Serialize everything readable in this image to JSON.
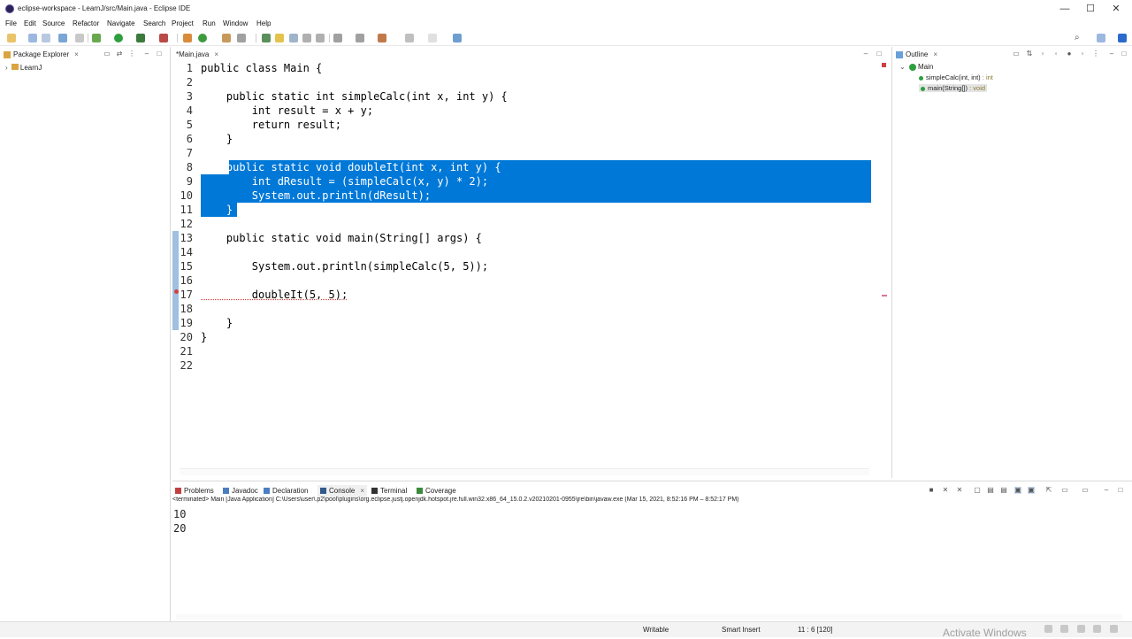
{
  "window": {
    "title": "eclipse-workspace - LearnJ/src/Main.java - Eclipse IDE",
    "minimize": "—",
    "maximize": "☐",
    "close": "✕"
  },
  "menu": [
    "File",
    "Edit",
    "Source",
    "Refactor",
    "Navigate",
    "Search",
    "Project",
    "Run",
    "Window",
    "Help"
  ],
  "left_panel": {
    "tab": "Package Explorer",
    "tree": [
      "LearnJ"
    ]
  },
  "editor": {
    "tab": "*Main.java",
    "lines": [
      {
        "n": "1",
        "code": "public class Main {"
      },
      {
        "n": "2",
        "code": ""
      },
      {
        "n": "3",
        "code": "    public static int simpleCalc(int x, int y) {"
      },
      {
        "n": "4",
        "code": "        int result = x + y;"
      },
      {
        "n": "5",
        "code": "        return result;"
      },
      {
        "n": "6",
        "code": "    }"
      },
      {
        "n": "7",
        "code": ""
      },
      {
        "n": "8",
        "code": "    public static void doubleIt(int x, int y) {"
      },
      {
        "n": "9",
        "code": "        int dResult = (simpleCalc(x, y) * 2);"
      },
      {
        "n": "10",
        "code": "        System.out.println(dResult);"
      },
      {
        "n": "11",
        "code": "    }"
      },
      {
        "n": "12",
        "code": ""
      },
      {
        "n": "13",
        "code": "    public static void main(String[] args) {"
      },
      {
        "n": "14",
        "code": ""
      },
      {
        "n": "15",
        "code": "        System.out.println(simpleCalc(5, 5));"
      },
      {
        "n": "16",
        "code": ""
      },
      {
        "n": "17",
        "code": "        doubleIt(5, 5);"
      },
      {
        "n": "18",
        "code": ""
      },
      {
        "n": "19",
        "code": "    }"
      },
      {
        "n": "20",
        "code": "}"
      },
      {
        "n": "21",
        "code": ""
      },
      {
        "n": "22",
        "code": ""
      }
    ]
  },
  "outline": {
    "tab": "Outline",
    "root": "Main",
    "items": [
      {
        "label": "simpleCalc(int, int)",
        "type": " : int"
      },
      {
        "label": "main(String[])",
        "type": " : void"
      }
    ]
  },
  "bottom": {
    "tabs": [
      "Problems",
      "Javadoc",
      "Declaration",
      "Console",
      "Terminal",
      "Coverage"
    ],
    "active_tab": "Console",
    "terminated": "<terminated> Main [Java Application] C:\\Users\\user\\.p2\\pool\\plugins\\org.eclipse.justj.openjdk.hotspot.jre.full.win32.x86_64_15.0.2.v20210201-0955\\jre\\bin\\javaw.exe  (Mar 15, 2021, 8:52:16 PM – 8:52:17 PM)",
    "output": [
      "10",
      "20"
    ]
  },
  "status": {
    "writable": "Writable",
    "insert": "Smart Insert",
    "position": "11 : 6 [120]",
    "activate": "Activate Windows"
  },
  "colors": {
    "selection": "#0078d7",
    "accent": "#2a6acc",
    "status_bg": "#f3f3f3"
  }
}
